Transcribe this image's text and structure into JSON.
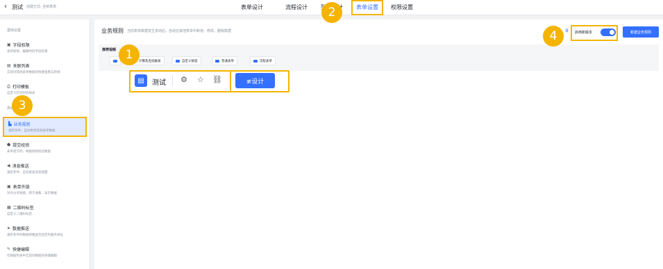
{
  "topbar": {
    "back_icon": "chevron-left",
    "app_title": "测试",
    "created_by": "创建方式: 全新表单",
    "tabs": [
      {
        "label": "表单设计"
      },
      {
        "label": "流程设计"
      },
      {
        "label": "列表设计"
      },
      {
        "label": "表单设置"
      },
      {
        "label": "权限设置"
      }
    ],
    "active_tab": "表单设置"
  },
  "sidebar": {
    "section_basic": "基础设置",
    "section_advanced": "高级设置",
    "items": [
      {
        "title": "字段权限",
        "sub": "表单权限，编辑时的字段权限",
        "icon": "lock-icon"
      },
      {
        "title": "关联列表",
        "sub": "实现对其他表单数据的快捷查看与新增",
        "icon": "link-icon"
      },
      {
        "title": "打印模板",
        "sub": "自定义打印时的样式",
        "icon": "printer-icon"
      },
      {
        "title": "业务规则",
        "sub": "满足条件，自动更改其他表单数据",
        "icon": "document-icon"
      },
      {
        "title": "提交校验",
        "sub": "表单提交时，根据规则校验数据",
        "icon": "shield-icon"
      },
      {
        "title": "消息推送",
        "sub": "满足条件，自动发送消息提醒",
        "icon": "megaphone-icon"
      },
      {
        "title": "表单外链",
        "sub": "对外分享链接，用于收集、表示数据",
        "icon": "external-icon"
      },
      {
        "title": "二维码标签",
        "sub": "自定义二维码标签",
        "icon": "qrcode-icon"
      },
      {
        "title": "数据推送",
        "sub": "满足条件的数据将推送至指定的服务地址",
        "icon": "send-icon"
      },
      {
        "title": "快捷编辑",
        "sub": "在数据列表中实现对数据的快捷编辑",
        "icon": "edit-icon"
      }
    ]
  },
  "main": {
    "title": "业务规则",
    "description": "当前表单数据发生变动后，自动在其他表单中新增、修改、删除数据",
    "link_text": "录",
    "toggle_label": "启用新版本",
    "toggle_on": true,
    "new_rule_button": "新建业务规则",
    "reco_title": "推荐视频",
    "chips": [
      "计算及连续触发",
      "自定义按钮",
      "普通表单",
      "流程表单"
    ]
  },
  "floating_toolbar": {
    "app_name": "测试",
    "icons": [
      "gear-icon",
      "star-icon",
      "link-icon"
    ],
    "design_button": "≢设计"
  },
  "markers": [
    "1",
    "2",
    "3",
    "4"
  ],
  "colors": {
    "accent": "#3370ff",
    "highlight": "#f5b400"
  }
}
